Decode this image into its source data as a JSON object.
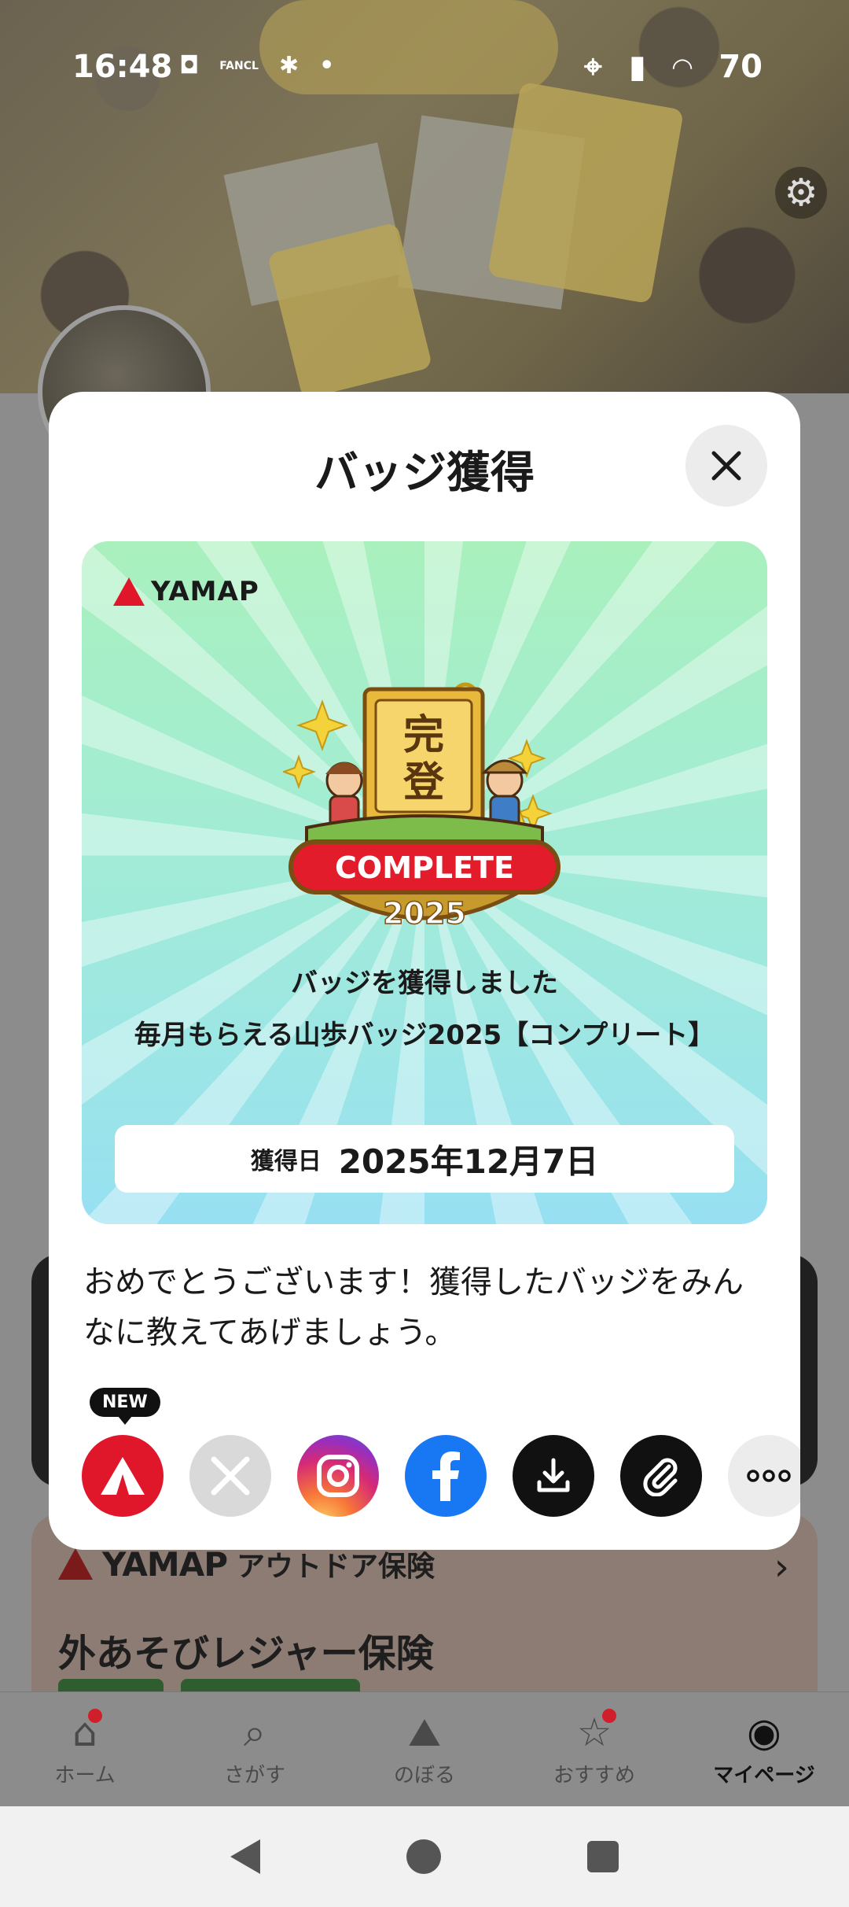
{
  "status_bar": {
    "time": "16:48",
    "battery": "70",
    "app_label": "FANCL"
  },
  "modal": {
    "title": "バッジ獲得",
    "card": {
      "brand": "YAMAP",
      "emblem_kanji_top": "完",
      "emblem_kanji_bottom": "登",
      "emblem_banner": "COMPLETE",
      "emblem_year": "2025",
      "line1": "バッジを獲得しました",
      "line2": "毎月もらえる山歩バッジ2025【コンプリート】",
      "date_label": "獲得日",
      "date_value": "2025年12月7日"
    },
    "congrats_text": "おめでとうございます！獲得したバッジをみんなに教えてあげましょう。",
    "new_tag": "NEW",
    "share_buttons": [
      {
        "name": "yamap-share",
        "icon": "yamap-icon",
        "color": "#e0162b"
      },
      {
        "name": "x-share",
        "icon": "x-icon",
        "color": "#d9d9d9"
      },
      {
        "name": "instagram-share",
        "icon": "instagram-icon",
        "color": "#d62976"
      },
      {
        "name": "facebook-share",
        "icon": "facebook-icon",
        "color": "#1877f2"
      },
      {
        "name": "download",
        "icon": "download-icon",
        "color": "#111111"
      },
      {
        "name": "copy-link",
        "icon": "link-icon",
        "color": "#111111"
      },
      {
        "name": "more",
        "icon": "more-icon",
        "color": "#ececec"
      }
    ]
  },
  "background": {
    "insurance_brand": "YAMAP",
    "insurance_subtitle": "アウトドア保険",
    "insurance_title": "外あそびレジャー保険"
  },
  "bottom_nav": [
    {
      "label": "ホーム",
      "icon": "home-icon",
      "dot": true,
      "active": false
    },
    {
      "label": "さがす",
      "icon": "map-search-icon",
      "dot": false,
      "active": false
    },
    {
      "label": "のぼる",
      "icon": "mountain-icon",
      "dot": false,
      "active": false
    },
    {
      "label": "おすすめ",
      "icon": "star-icon",
      "dot": true,
      "active": false
    },
    {
      "label": "マイページ",
      "icon": "profile-icon",
      "dot": false,
      "active": true
    }
  ]
}
